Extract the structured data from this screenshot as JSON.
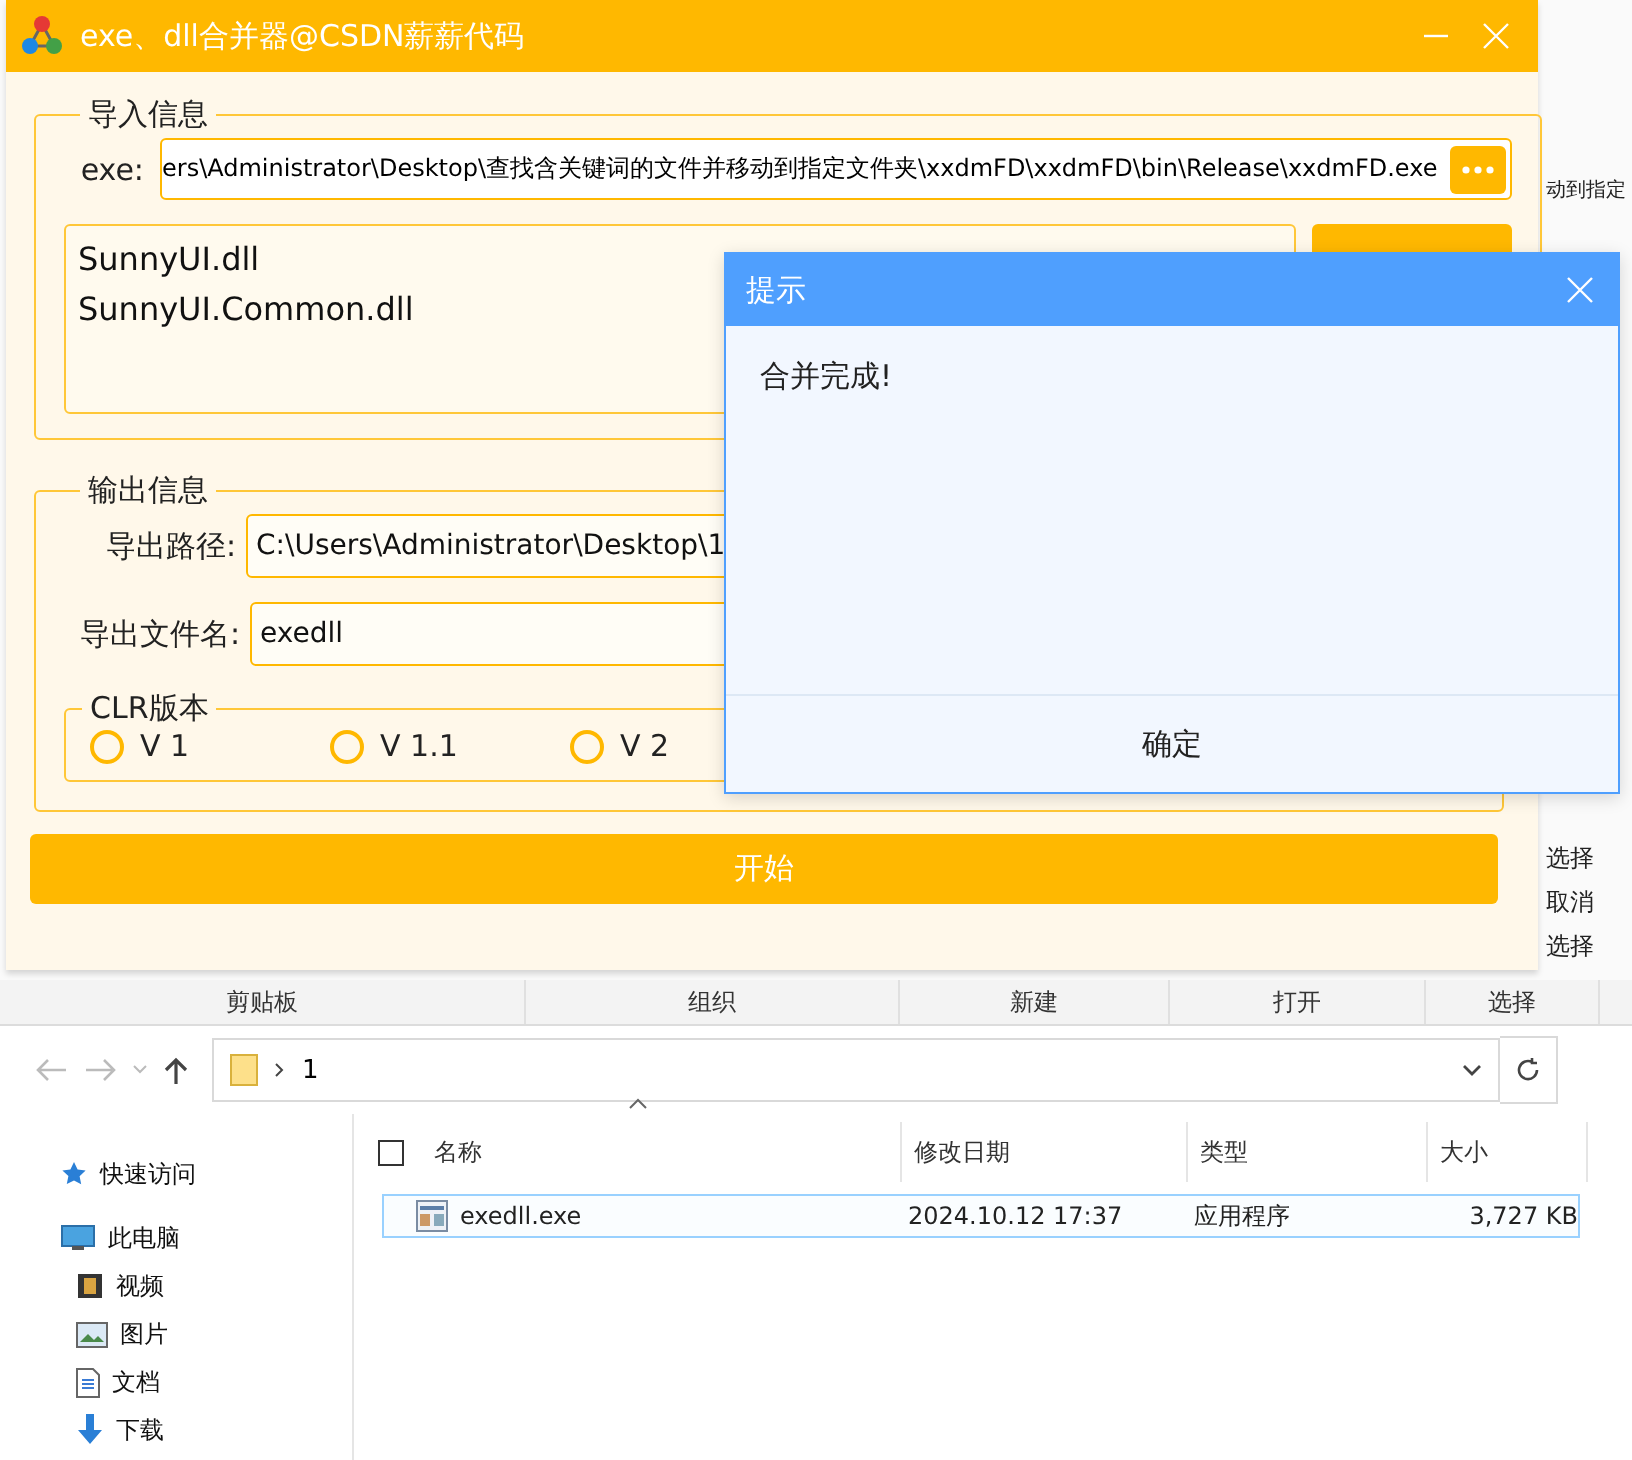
{
  "background_window": {
    "ribbon_items": [
      {
        "label": "动到指定"
      },
      {
        "label": "选择"
      },
      {
        "label": "取消"
      },
      {
        "label": "选择"
      }
    ],
    "ribbon_groups": [
      "剪贴板",
      "组织",
      "新建",
      "打开",
      "选择"
    ],
    "address_path": "1",
    "nav_items": [
      {
        "label": "快速访问",
        "kind": "star"
      },
      {
        "label": "此电脑",
        "kind": "pc",
        "children": [
          {
            "label": "视频",
            "kind": "video"
          },
          {
            "label": "图片",
            "kind": "picture"
          },
          {
            "label": "文档",
            "kind": "document"
          },
          {
            "label": "下载",
            "kind": "download"
          }
        ]
      }
    ],
    "select_all": {
      "checked": false
    },
    "columns": [
      "名称",
      "修改日期",
      "类型",
      "大小"
    ],
    "rows": [
      {
        "name": "exedll.exe",
        "modified": "2024.10.12 17:37",
        "type": "应用程序",
        "size": "3,727 KB",
        "selected": true
      }
    ]
  },
  "app": {
    "title": "exe、dll合并器@CSDN薪薪代码",
    "import_group": {
      "legend": "导入信息",
      "exe_label": "exe:",
      "exe_path": "ers\\Administrator\\Desktop\\查找含关键词的文件并移动到指定文件夹\\xxdmFD\\xxdmFD\\bin\\Release\\xxdmFD.exe",
      "files": [
        "SunnyUI.dll",
        "SunnyUI.Common.dll"
      ]
    },
    "output_group": {
      "legend": "输出信息",
      "fields": [
        {
          "label": "导出路径:",
          "value": "C:\\Users\\Administrator\\Desktop\\1"
        },
        {
          "label": "导出文件名:",
          "value": "exedll"
        }
      ],
      "clr": {
        "legend": "CLR版本",
        "options": [
          {
            "label": "V 1",
            "selected": false
          },
          {
            "label": "V 1.1",
            "selected": false
          },
          {
            "label": "V 2",
            "selected": false
          }
        ]
      }
    },
    "start_button": "开始"
  },
  "dialog": {
    "title": "提示",
    "message": "合并完成!",
    "ok_button": "确定"
  }
}
